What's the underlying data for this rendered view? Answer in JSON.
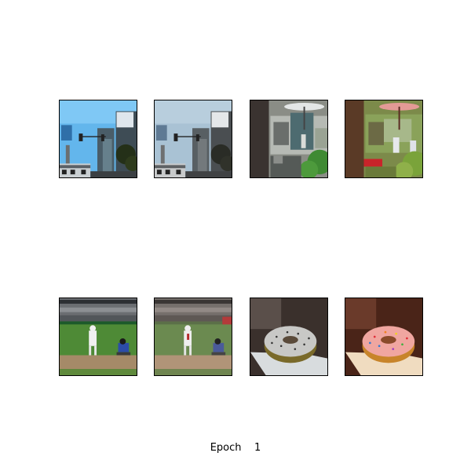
{
  "caption": {
    "label": "Epoch",
    "value": "1"
  },
  "panels": [
    {
      "row": 1,
      "col": 1,
      "subject": "street-scene-traffic-lights"
    },
    {
      "row": 1,
      "col": 2,
      "subject": "street-scene-traffic-lights"
    },
    {
      "row": 1,
      "col": 3,
      "subject": "park-with-red-umbrella"
    },
    {
      "row": 1,
      "col": 4,
      "subject": "park-with-red-umbrella"
    },
    {
      "row": 2,
      "col": 1,
      "subject": "baseball-game"
    },
    {
      "row": 2,
      "col": 2,
      "subject": "baseball-game"
    },
    {
      "row": 2,
      "col": 3,
      "subject": "frosted-donut"
    },
    {
      "row": 2,
      "col": 4,
      "subject": "frosted-donut"
    }
  ]
}
